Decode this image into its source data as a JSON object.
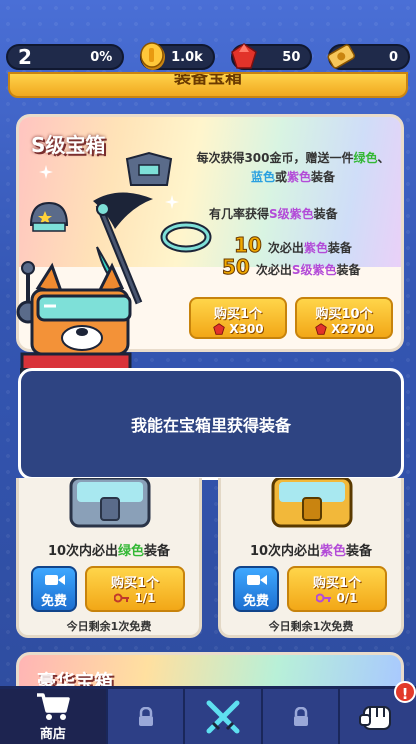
{
  "top_bar": {
    "level": "2",
    "progress": "0%",
    "coins": "1.0k",
    "gems": "50",
    "tickets": "0"
  },
  "header_title": "装备宝箱",
  "s_chest": {
    "title": "S级宝箱",
    "desc_line1_a": "每次获得300金币，赠送一件",
    "desc_green": "绿色",
    "desc_sep1": "、",
    "desc_blue": "蓝色",
    "desc_or": "或",
    "desc_purple": "紫色",
    "desc_tail": "装备",
    "chance_a": "有几率获得",
    "chance_b": "S级紫色",
    "chance_c": "装备",
    "guarantee1_num": "10",
    "guarantee1_a": "次必出",
    "guarantee1_b": "紫色",
    "guarantee1_c": "装备",
    "guarantee2_num": "50",
    "guarantee2_a": "次必出",
    "guarantee2_b": "S级紫色",
    "guarantee2_c": "装备",
    "buy1_label": "购买1个",
    "buy1_cost": "X300",
    "buy10_label": "购买10个",
    "buy10_cost": "X2700"
  },
  "dialog_text": "我能在宝箱里获得装备",
  "left_chest": {
    "guarantee_a": "10次内必出",
    "guarantee_b": "绿色",
    "guarantee_c": "装备",
    "video_label": "免费",
    "buy_label": "购买1个",
    "key_count": "1/1",
    "free_left": "今日剩余1次免费"
  },
  "right_chest": {
    "guarantee_a": "10次内必出",
    "guarantee_b": "紫色",
    "guarantee_c": "装备",
    "video_label": "免费",
    "buy_label": "购买1个",
    "key_count": "0/1",
    "free_left": "今日剩余1次免费"
  },
  "lux_chest": {
    "title": "豪华宝箱"
  },
  "nav": {
    "shop_label": "商店",
    "badge": "!"
  },
  "colors": {
    "accent_gold": "#f2a717",
    "nav_bg": "#2d3f86",
    "dialog_bg": "#2e4482",
    "green": "#34b836",
    "blue": "#2aa0e0",
    "purple": "#b34bd8"
  }
}
